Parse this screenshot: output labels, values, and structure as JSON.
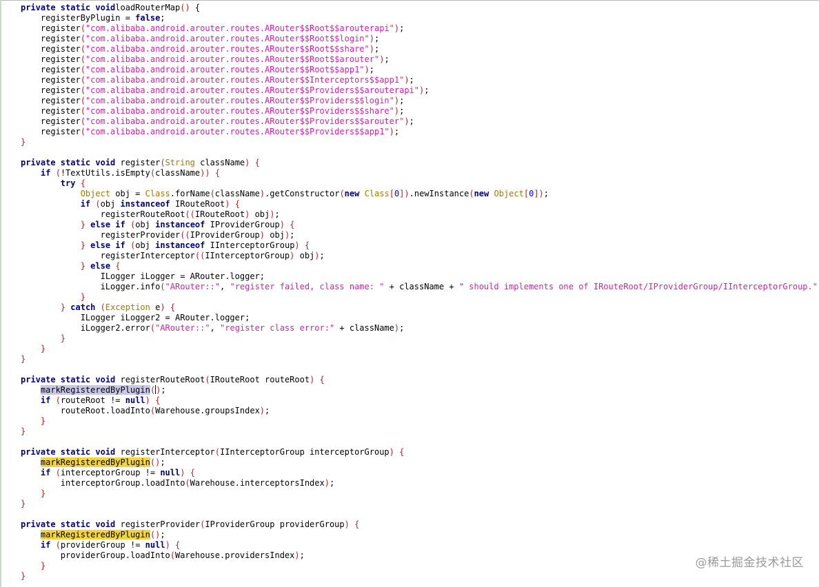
{
  "watermark": "@稀土掘金技术社区",
  "colors": {
    "keyword": "#000080",
    "string": "#d61fa8",
    "number": "#0000ff",
    "class": "#a07a00",
    "paren": "#c02020",
    "highlight_selected": "#c8c8e6",
    "highlight_occurrence": "#f5d33a"
  },
  "code_lines": [
    [
      [
        "kw",
        "private static void"
      ],
      [
        "",
        "loadRouterMap"
      ],
      [
        "par",
        "()"
      ],
      [
        "",
        " {"
      ]
    ],
    [
      [
        "",
        "    registerByPlugin = "
      ],
      [
        "kw",
        "false"
      ],
      [
        "",
        ";"
      ]
    ],
    [
      [
        "",
        "    register"
      ],
      [
        "par",
        "("
      ],
      [
        "str",
        "\"com.alibaba.android.arouter.routes.ARouter$$Root$$arouterapi\""
      ],
      [
        "par",
        ")"
      ],
      [
        "",
        ";"
      ]
    ],
    [
      [
        "",
        "    register"
      ],
      [
        "par",
        "("
      ],
      [
        "str",
        "\"com.alibaba.android.arouter.routes.ARouter$$Root$$login\""
      ],
      [
        "par",
        ")"
      ],
      [
        "",
        ";"
      ]
    ],
    [
      [
        "",
        "    register"
      ],
      [
        "par",
        "("
      ],
      [
        "str",
        "\"com.alibaba.android.arouter.routes.ARouter$$Root$$share\""
      ],
      [
        "par",
        ")"
      ],
      [
        "",
        ";"
      ]
    ],
    [
      [
        "",
        "    register"
      ],
      [
        "par",
        "("
      ],
      [
        "str",
        "\"com.alibaba.android.arouter.routes.ARouter$$Root$$arouter\""
      ],
      [
        "par",
        ")"
      ],
      [
        "",
        ";"
      ]
    ],
    [
      [
        "",
        "    register"
      ],
      [
        "par",
        "("
      ],
      [
        "str",
        "\"com.alibaba.android.arouter.routes.ARouter$$Root$$app1\""
      ],
      [
        "par",
        ")"
      ],
      [
        "",
        ";"
      ]
    ],
    [
      [
        "",
        "    register"
      ],
      [
        "par",
        "("
      ],
      [
        "str",
        "\"com.alibaba.android.arouter.routes.ARouter$$Interceptors$$app1\""
      ],
      [
        "par",
        ")"
      ],
      [
        "",
        ";"
      ]
    ],
    [
      [
        "",
        "    register"
      ],
      [
        "par",
        "("
      ],
      [
        "str",
        "\"com.alibaba.android.arouter.routes.ARouter$$Providers$$arouterapi\""
      ],
      [
        "par",
        ")"
      ],
      [
        "",
        ";"
      ]
    ],
    [
      [
        "",
        "    register"
      ],
      [
        "par",
        "("
      ],
      [
        "str",
        "\"com.alibaba.android.arouter.routes.ARouter$$Providers$$login\""
      ],
      [
        "par",
        ")"
      ],
      [
        "",
        ";"
      ]
    ],
    [
      [
        "",
        "    register"
      ],
      [
        "par",
        "("
      ],
      [
        "str",
        "\"com.alibaba.android.arouter.routes.ARouter$$Providers$$share\""
      ],
      [
        "par",
        ")"
      ],
      [
        "",
        ";"
      ]
    ],
    [
      [
        "",
        "    register"
      ],
      [
        "par",
        "("
      ],
      [
        "str",
        "\"com.alibaba.android.arouter.routes.ARouter$$Providers$$arouter\""
      ],
      [
        "par",
        ")"
      ],
      [
        "",
        ";"
      ]
    ],
    [
      [
        "",
        "    register"
      ],
      [
        "par",
        "("
      ],
      [
        "str",
        "\"com.alibaba.android.arouter.routes.ARouter$$Providers$$app1\""
      ],
      [
        "par",
        ")"
      ],
      [
        "",
        ";"
      ]
    ],
    [
      [
        "par",
        "}"
      ]
    ],
    [],
    [
      [
        "kw",
        "private static void"
      ],
      [
        "",
        " register"
      ],
      [
        "par",
        "("
      ],
      [
        "cls",
        "String"
      ],
      [
        "",
        " className"
      ],
      [
        "par",
        ")"
      ],
      [
        "",
        " "
      ],
      [
        "par",
        "{"
      ]
    ],
    [
      [
        "",
        "    "
      ],
      [
        "kw",
        "if"
      ],
      [
        "",
        " "
      ],
      [
        "par",
        "("
      ],
      [
        "",
        "!TextUtils.isEmpty"
      ],
      [
        "par",
        "("
      ],
      [
        "",
        "className"
      ],
      [
        "par",
        "))"
      ],
      [
        "",
        " "
      ],
      [
        "par",
        "{"
      ]
    ],
    [
      [
        "",
        "        "
      ],
      [
        "kw",
        "try"
      ],
      [
        "",
        " "
      ],
      [
        "par",
        "{"
      ]
    ],
    [
      [
        "",
        "            "
      ],
      [
        "cls",
        "Object"
      ],
      [
        "",
        " obj = "
      ],
      [
        "cls",
        "Class"
      ],
      [
        "",
        ".forName"
      ],
      [
        "par",
        "("
      ],
      [
        "",
        "className"
      ],
      [
        "par",
        ")"
      ],
      [
        "",
        ".getConstructor"
      ],
      [
        "par",
        "("
      ],
      [
        "kw",
        "new"
      ],
      [
        "",
        " "
      ],
      [
        "cls",
        "Class"
      ],
      [
        "par",
        "["
      ],
      [
        "num",
        "0"
      ],
      [
        "par",
        "])"
      ],
      [
        "",
        ".newInstance"
      ],
      [
        "par",
        "("
      ],
      [
        "kw",
        "new"
      ],
      [
        "",
        " "
      ],
      [
        "cls",
        "Object"
      ],
      [
        "par",
        "["
      ],
      [
        "num",
        "0"
      ],
      [
        "par",
        "])"
      ],
      [
        "",
        ";"
      ]
    ],
    [
      [
        "",
        "            "
      ],
      [
        "kw",
        "if"
      ],
      [
        "",
        " "
      ],
      [
        "par",
        "("
      ],
      [
        "",
        "obj "
      ],
      [
        "kw",
        "instanceof"
      ],
      [
        "",
        " IRouteRoot"
      ],
      [
        "par",
        ")"
      ],
      [
        "",
        " "
      ],
      [
        "par",
        "{"
      ]
    ],
    [
      [
        "",
        "                registerRouteRoot"
      ],
      [
        "par",
        "(("
      ],
      [
        "",
        "IRouteRoot"
      ],
      [
        "par",
        ")"
      ],
      [
        "",
        " obj"
      ],
      [
        "par",
        ")"
      ],
      [
        "",
        ";"
      ]
    ],
    [
      [
        "",
        "            "
      ],
      [
        "par",
        "}"
      ],
      [
        "",
        " "
      ],
      [
        "kw",
        "else if"
      ],
      [
        "",
        " "
      ],
      [
        "par",
        "("
      ],
      [
        "",
        "obj "
      ],
      [
        "kw",
        "instanceof"
      ],
      [
        "",
        " IProviderGroup"
      ],
      [
        "par",
        ")"
      ],
      [
        "",
        " "
      ],
      [
        "par",
        "{"
      ]
    ],
    [
      [
        "",
        "                registerProvider"
      ],
      [
        "par",
        "(("
      ],
      [
        "",
        "IProviderGroup"
      ],
      [
        "par",
        ")"
      ],
      [
        "",
        " obj"
      ],
      [
        "par",
        ")"
      ],
      [
        "",
        ";"
      ]
    ],
    [
      [
        "",
        "            "
      ],
      [
        "par",
        "}"
      ],
      [
        "",
        " "
      ],
      [
        "kw",
        "else if"
      ],
      [
        "",
        " "
      ],
      [
        "par",
        "("
      ],
      [
        "",
        "obj "
      ],
      [
        "kw",
        "instanceof"
      ],
      [
        "",
        " IInterceptorGroup"
      ],
      [
        "par",
        ")"
      ],
      [
        "",
        " "
      ],
      [
        "par",
        "{"
      ]
    ],
    [
      [
        "",
        "                registerInterceptor"
      ],
      [
        "par",
        "(("
      ],
      [
        "",
        "IInterceptorGroup"
      ],
      [
        "par",
        ")"
      ],
      [
        "",
        " obj"
      ],
      [
        "par",
        ")"
      ],
      [
        "",
        ";"
      ]
    ],
    [
      [
        "",
        "            "
      ],
      [
        "par",
        "}"
      ],
      [
        "",
        " "
      ],
      [
        "kw",
        "else"
      ],
      [
        "",
        " "
      ],
      [
        "par",
        "{"
      ]
    ],
    [
      [
        "",
        "                ILogger iLogger = ARouter.logger;"
      ]
    ],
    [
      [
        "",
        "                iLogger.info"
      ],
      [
        "par",
        "("
      ],
      [
        "str",
        "\"ARouter::\""
      ],
      [
        "",
        ", "
      ],
      [
        "str",
        "\"register failed, class name: \""
      ],
      [
        "",
        " + className + "
      ],
      [
        "str",
        "\" should implements one of IRouteRoot/IProviderGroup/IInterceptorGroup.\""
      ],
      [
        "par",
        ")"
      ],
      [
        "",
        ";"
      ]
    ],
    [
      [
        "",
        "            "
      ],
      [
        "par",
        "}"
      ]
    ],
    [
      [
        "",
        "        "
      ],
      [
        "par",
        "}"
      ],
      [
        "",
        " "
      ],
      [
        "kw",
        "catch"
      ],
      [
        "",
        " "
      ],
      [
        "par",
        "("
      ],
      [
        "cls",
        "Exception"
      ],
      [
        "",
        " e"
      ],
      [
        "par",
        ")"
      ],
      [
        "",
        " "
      ],
      [
        "par",
        "{"
      ]
    ],
    [
      [
        "",
        "            ILogger iLogger2 = ARouter.logger;"
      ]
    ],
    [
      [
        "",
        "            iLogger2.error"
      ],
      [
        "par",
        "("
      ],
      [
        "str",
        "\"ARouter::\""
      ],
      [
        "",
        ", "
      ],
      [
        "str",
        "\"register class error:\""
      ],
      [
        "",
        " + className"
      ],
      [
        "par",
        ")"
      ],
      [
        "",
        ";"
      ]
    ],
    [
      [
        "",
        "        "
      ],
      [
        "par",
        "}"
      ]
    ],
    [
      [
        "",
        "    "
      ],
      [
        "par",
        "}"
      ]
    ],
    [
      [
        "par",
        "}"
      ]
    ],
    [],
    [
      [
        "kw",
        "private static void"
      ],
      [
        "",
        " registerRouteRoot"
      ],
      [
        "par",
        "("
      ],
      [
        "",
        "IRouteRoot routeRoot"
      ],
      [
        "par",
        ")"
      ],
      [
        "",
        " "
      ],
      [
        "par",
        "{"
      ]
    ],
    [
      [
        "",
        "    "
      ],
      [
        "hl-sel",
        "markRegisteredByPlugin"
      ],
      [
        "par",
        "("
      ],
      [
        "cursor",
        ""
      ],
      [
        "par",
        ")"
      ],
      [
        "",
        ";"
      ]
    ],
    [
      [
        "",
        "    "
      ],
      [
        "kw",
        "if"
      ],
      [
        "",
        " "
      ],
      [
        "par",
        "("
      ],
      [
        "",
        "routeRoot != "
      ],
      [
        "kw",
        "null"
      ],
      [
        "par",
        ")"
      ],
      [
        "",
        " "
      ],
      [
        "par",
        "{"
      ]
    ],
    [
      [
        "",
        "        routeRoot.loadInto"
      ],
      [
        "par",
        "("
      ],
      [
        "",
        "Warehouse.groupsIndex"
      ],
      [
        "par",
        ")"
      ],
      [
        "",
        ";"
      ]
    ],
    [
      [
        "",
        "    "
      ],
      [
        "par",
        "}"
      ]
    ],
    [
      [
        "par",
        "}"
      ]
    ],
    [],
    [
      [
        "kw",
        "private static void"
      ],
      [
        "",
        " registerInterceptor"
      ],
      [
        "par",
        "("
      ],
      [
        "",
        "IInterceptorGroup interceptorGroup"
      ],
      [
        "par",
        ")"
      ],
      [
        "",
        " "
      ],
      [
        "par",
        "{"
      ]
    ],
    [
      [
        "",
        "    "
      ],
      [
        "hl-yel",
        "markRegisteredByPlugin"
      ],
      [
        "par",
        "()"
      ],
      [
        "",
        ";"
      ]
    ],
    [
      [
        "",
        "    "
      ],
      [
        "kw",
        "if"
      ],
      [
        "",
        " "
      ],
      [
        "par",
        "("
      ],
      [
        "",
        "interceptorGroup != "
      ],
      [
        "kw",
        "null"
      ],
      [
        "par",
        ")"
      ],
      [
        "",
        " "
      ],
      [
        "par",
        "{"
      ]
    ],
    [
      [
        "",
        "        interceptorGroup.loadInto"
      ],
      [
        "par",
        "("
      ],
      [
        "",
        "Warehouse.interceptorsIndex"
      ],
      [
        "par",
        ")"
      ],
      [
        "",
        ";"
      ]
    ],
    [
      [
        "",
        "    "
      ],
      [
        "par",
        "}"
      ]
    ],
    [
      [
        "par",
        "}"
      ]
    ],
    [],
    [
      [
        "kw",
        "private static void"
      ],
      [
        "",
        " registerProvider"
      ],
      [
        "par",
        "("
      ],
      [
        "",
        "IProviderGroup providerGroup"
      ],
      [
        "par",
        ")"
      ],
      [
        "",
        " "
      ],
      [
        "par",
        "{"
      ]
    ],
    [
      [
        "",
        "    "
      ],
      [
        "hl-yel",
        "markRegisteredByPlugin"
      ],
      [
        "par",
        "()"
      ],
      [
        "",
        ";"
      ]
    ],
    [
      [
        "",
        "    "
      ],
      [
        "kw",
        "if"
      ],
      [
        "",
        " "
      ],
      [
        "par",
        "("
      ],
      [
        "",
        "providerGroup != "
      ],
      [
        "kw",
        "null"
      ],
      [
        "par",
        ")"
      ],
      [
        "",
        " "
      ],
      [
        "par",
        "{"
      ]
    ],
    [
      [
        "",
        "        providerGroup.loadInto"
      ],
      [
        "par",
        "("
      ],
      [
        "",
        "Warehouse.providersIndex"
      ],
      [
        "par",
        ")"
      ],
      [
        "",
        ";"
      ]
    ],
    [
      [
        "",
        "    "
      ],
      [
        "par",
        "}"
      ]
    ],
    [
      [
        "par",
        "}"
      ]
    ]
  ]
}
